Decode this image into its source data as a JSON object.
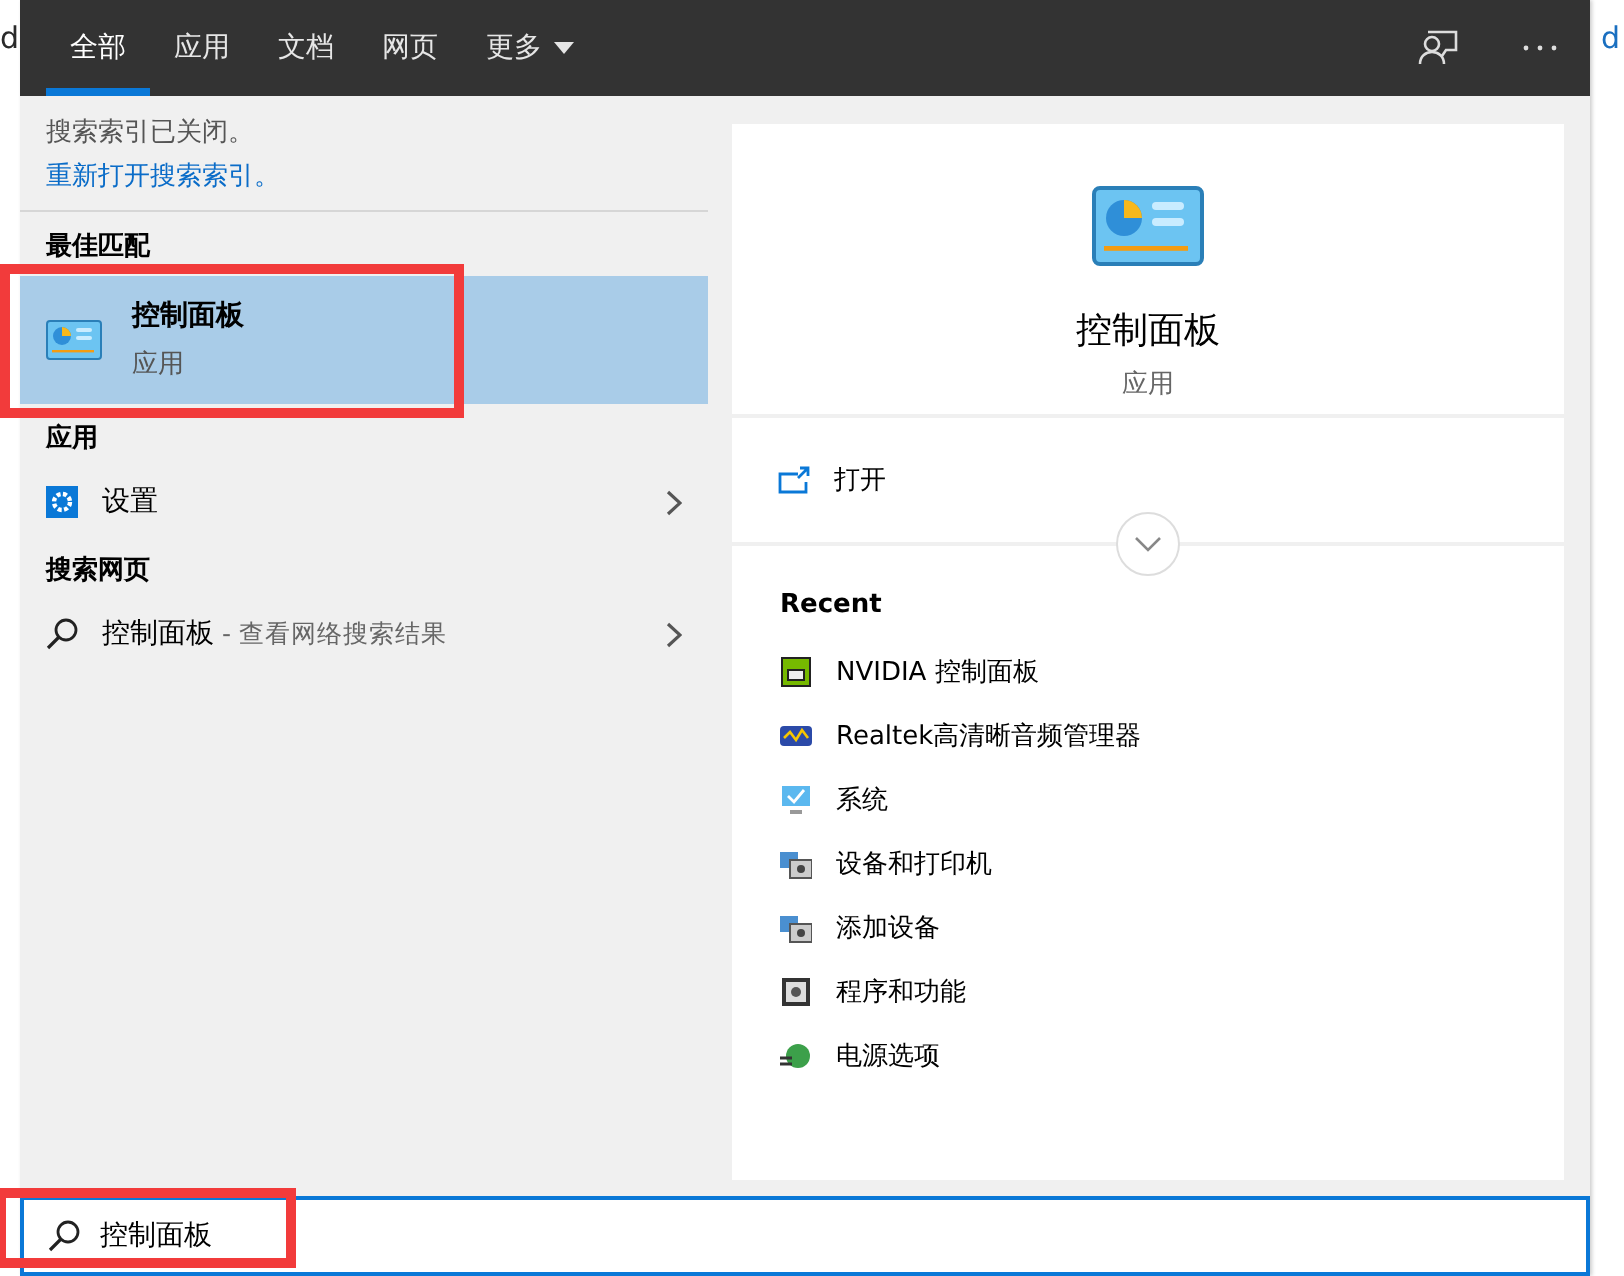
{
  "backdrop": {
    "left_text": "d",
    "right_text": "d"
  },
  "tabs": [
    {
      "label": "全部",
      "selected": true,
      "dropdown": false
    },
    {
      "label": "应用",
      "selected": false,
      "dropdown": false
    },
    {
      "label": "文档",
      "selected": false,
      "dropdown": false
    },
    {
      "label": "网页",
      "selected": false,
      "dropdown": false
    },
    {
      "label": "更多",
      "selected": false,
      "dropdown": true
    }
  ],
  "notice": {
    "text": "搜索索引已关闭。",
    "link": "重新打开搜索索引。"
  },
  "sections": [
    {
      "header": "最佳匹配",
      "items": [
        {
          "kind": "best",
          "title": "控制面板",
          "subtitle": "应用",
          "selected": true,
          "annotated": true
        }
      ]
    },
    {
      "header": "应用",
      "items": [
        {
          "kind": "app",
          "title": "设置",
          "selected": false
        }
      ]
    },
    {
      "header": "搜索网页",
      "items": [
        {
          "kind": "web",
          "title": "控制面板",
          "suffix": " - 查看网络搜索结果",
          "selected": false
        }
      ]
    }
  ],
  "preview": {
    "title": "控制面板",
    "subtitle": "应用",
    "action": "打开",
    "recent_header": "Recent",
    "recent": [
      {
        "label": "NVIDIA 控制面板"
      },
      {
        "label": "Realtek高清晰音频管理器"
      },
      {
        "label": "系统"
      },
      {
        "label": "设备和打印机"
      },
      {
        "label": "添加设备"
      },
      {
        "label": "程序和功能"
      },
      {
        "label": "电源选项"
      }
    ]
  },
  "search": {
    "value": "控制面板",
    "annotated": true
  }
}
